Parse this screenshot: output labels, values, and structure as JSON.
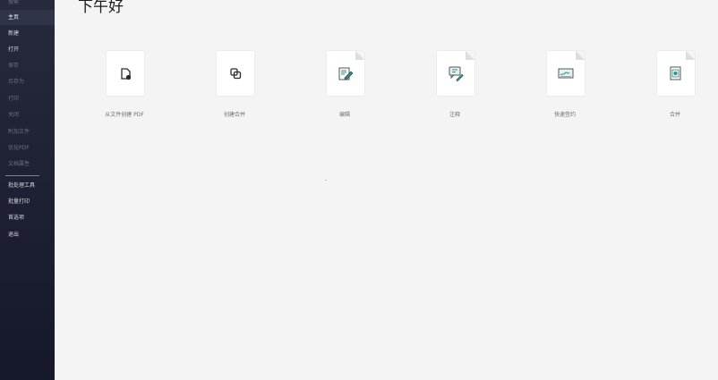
{
  "sidebar": {
    "items": [
      {
        "label": "搜索"
      },
      {
        "label": "主页"
      },
      {
        "label": "新建"
      },
      {
        "label": "打开"
      },
      {
        "label": "保存"
      },
      {
        "label": "另存为"
      },
      {
        "label": "打印"
      },
      {
        "label": "关闭"
      },
      {
        "label": "附加文件"
      },
      {
        "label": "优化PDF"
      },
      {
        "label": "文档属性"
      },
      {
        "label": "批处理工具"
      },
      {
        "label": "批量打印"
      },
      {
        "label": "首选项"
      },
      {
        "label": "退出"
      }
    ]
  },
  "main": {
    "greeting": "下午好",
    "tiles": [
      {
        "label": "从文件创建 PDF",
        "icon": "create-from-file-icon"
      },
      {
        "label": "创建合并",
        "icon": "create-combine-icon"
      },
      {
        "label": "编辑",
        "icon": "edit-icon"
      },
      {
        "label": "注释",
        "icon": "comment-icon"
      },
      {
        "label": "快速签约",
        "icon": "quick-sign-icon"
      },
      {
        "label": "合并",
        "icon": "merge-icon"
      }
    ]
  },
  "colors": {
    "sidebar_top": "#262a3c",
    "sidebar_bottom": "#15182a",
    "background": "#f4f4f4",
    "accent": "#2f8f8a"
  }
}
